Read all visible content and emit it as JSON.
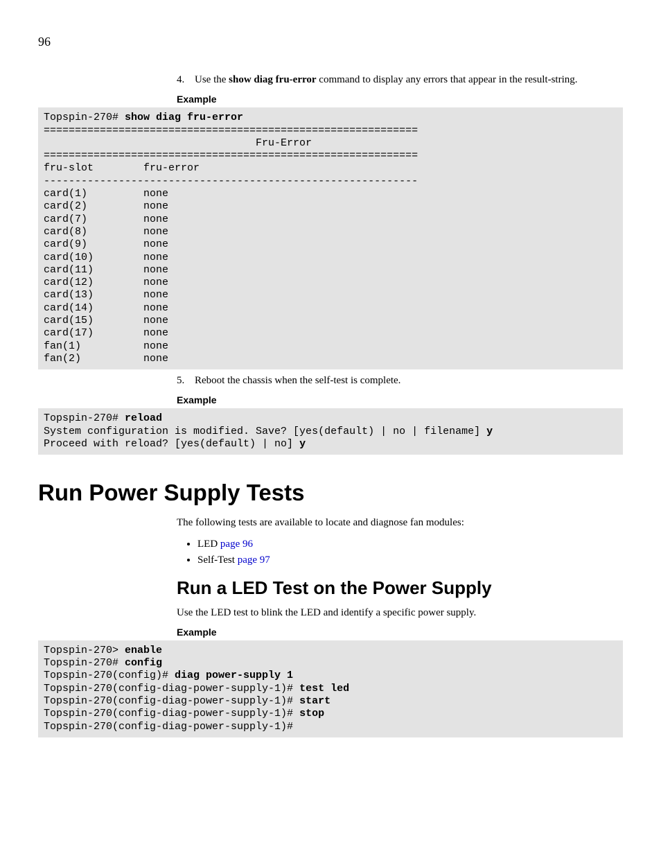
{
  "page_number": "96",
  "step4": {
    "num": "4.",
    "pre": "Use the ",
    "cmd": "show diag fru-error",
    "post": " command to display any errors that appear in the result-string."
  },
  "example_label": "Example",
  "code1": {
    "prompt1": "Topspin-270# ",
    "cmd1": "show diag fru-error",
    "sep_dbl": "============================================================",
    "title_line": "                                  Fru-Error",
    "header": "fru-slot        fru-error",
    "sep_sgl": "------------------------------------------------------------",
    "rows": [
      "card(1)         none",
      "card(2)         none",
      "card(7)         none",
      "card(8)         none",
      "card(9)         none",
      "card(10)        none",
      "card(11)        none",
      "card(12)        none",
      "card(13)        none",
      "card(14)        none",
      "card(15)        none",
      "card(17)        none",
      "fan(1)          none",
      "fan(2)          none"
    ]
  },
  "step5": {
    "num": "5.",
    "text": "Reboot the chassis when the self-test is complete."
  },
  "code2": {
    "p1_pre": "Topspin-270# ",
    "p1_cmd": "reload",
    "l2_pre": "System configuration is modified. Save? [yes(default) | no | filename] ",
    "l2_cmd": "y",
    "l3_pre": "Proceed with reload? [yes(default) | no] ",
    "l3_cmd": "y"
  },
  "h1": "Run Power Supply Tests",
  "intro": "The following tests are available to locate and diagnose fan modules:",
  "bullets": [
    {
      "label": "LED",
      "link": " page 96"
    },
    {
      "label": "Self-Test",
      "link": " page 97"
    }
  ],
  "h2": "Run a LED Test on the Power Supply",
  "h2_body": "Use the LED test to blink the LED and identify a specific power supply.",
  "code3": {
    "l1_pre": "Topspin-270> ",
    "l1_cmd": "enable",
    "l2_pre": "Topspin-270# ",
    "l2_cmd": "config",
    "l3_pre": "Topspin-270(config)# ",
    "l3_cmd": "diag power-supply 1",
    "l4_pre": "Topspin-270(config-diag-power-supply-1)# ",
    "l4_cmd": "test led",
    "l5_pre": "Topspin-270(config-diag-power-supply-1)# ",
    "l5_cmd": "start",
    "l6_pre": "Topspin-270(config-diag-power-supply-1)# ",
    "l6_cmd": "stop",
    "l7_pre": "Topspin-270(config-diag-power-supply-1)# "
  }
}
